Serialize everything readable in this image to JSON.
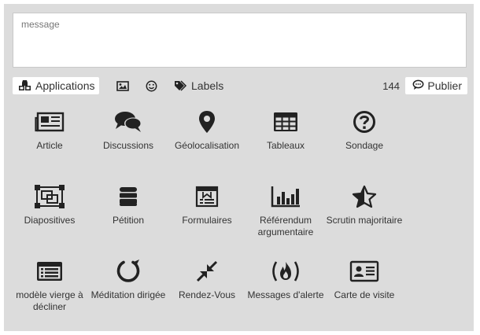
{
  "composer": {
    "placeholder": "message"
  },
  "toolbar": {
    "applications_label": "Applications",
    "labels_label": "Labels",
    "char_count": "144",
    "publish_label": "Publier"
  },
  "apps": [
    {
      "label": "Article",
      "icon": "newspaper-icon"
    },
    {
      "label": "Discussions",
      "icon": "comments-icon"
    },
    {
      "label": "Géolocalisation",
      "icon": "map-marker-icon"
    },
    {
      "label": "Tableaux",
      "icon": "table-icon"
    },
    {
      "label": "Sondage",
      "icon": "question-circle-icon"
    },
    {
      "label": "Diapositives",
      "icon": "object-group-icon"
    },
    {
      "label": "Pétition",
      "icon": "database-icon"
    },
    {
      "label": "Formulaires",
      "icon": "form-icon"
    },
    {
      "label": "Référendum argumentaire",
      "icon": "bar-chart-icon"
    },
    {
      "label": "Scrutin majoritaire",
      "icon": "star-half-icon"
    },
    {
      "label": "modèle vierge à décliner",
      "icon": "list-alt-icon"
    },
    {
      "label": "Méditation dirigée",
      "icon": "circle-notch-icon"
    },
    {
      "label": "Rendez-Vous",
      "icon": "compress-icon"
    },
    {
      "label": "Messages d'alerte",
      "icon": "fire-alert-icon"
    },
    {
      "label": "Carte de visite",
      "icon": "address-card-icon"
    }
  ]
}
